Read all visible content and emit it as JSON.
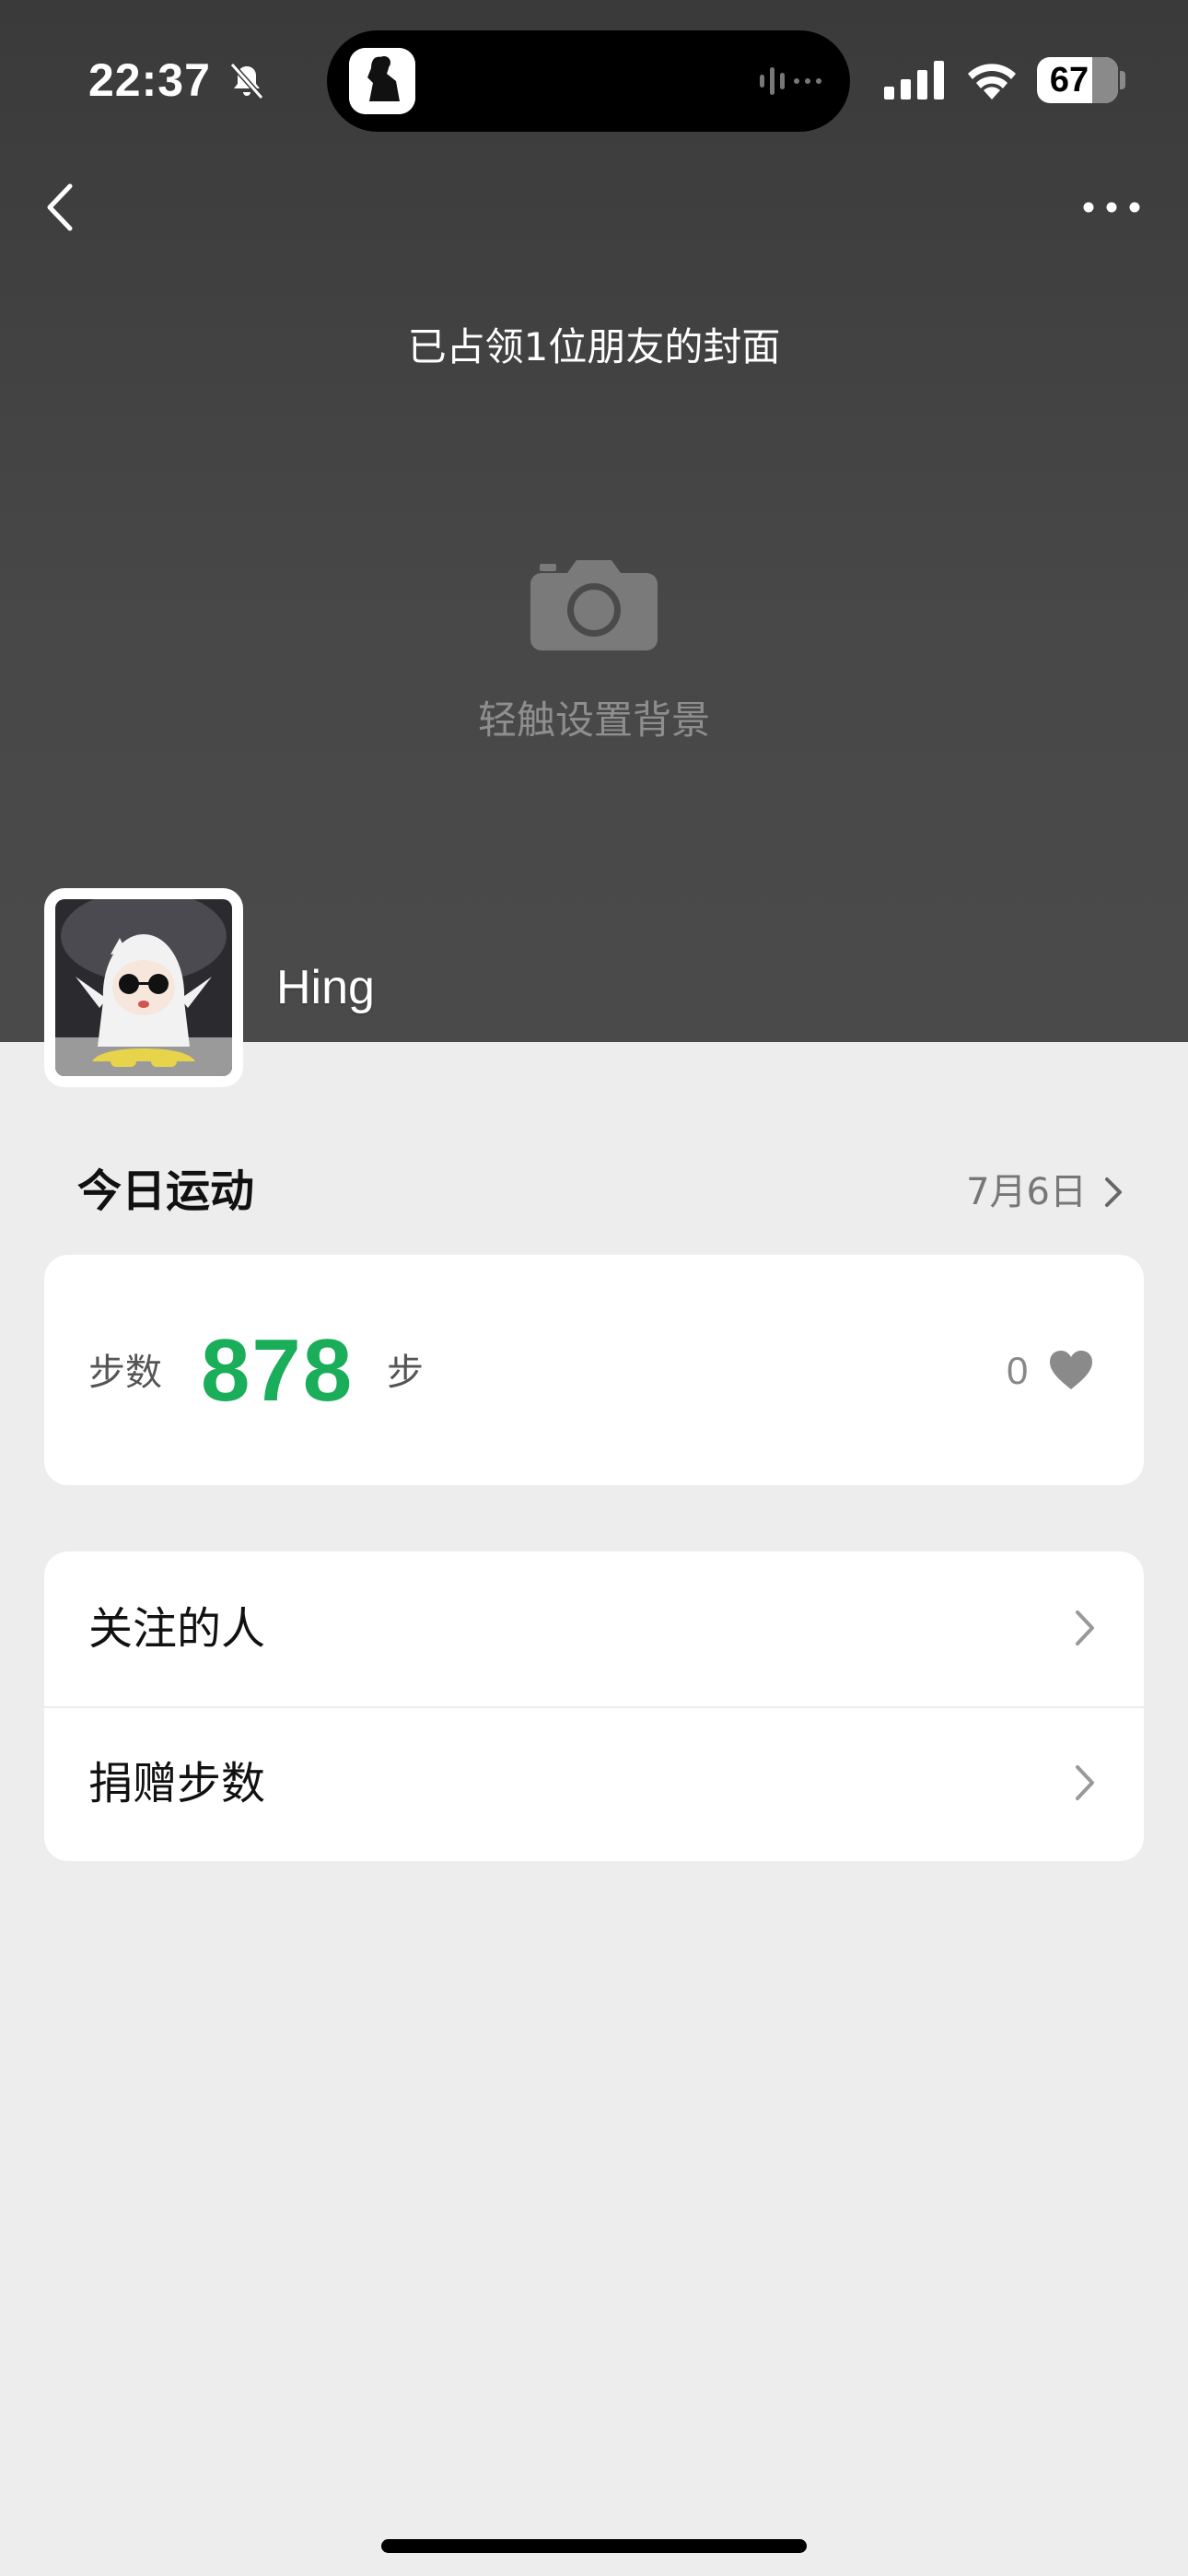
{
  "status_bar": {
    "time": "22:37",
    "battery": "67"
  },
  "header": {
    "cover_note": "已占领1位朋友的封面",
    "tap_to_set_background": "轻触设置背景"
  },
  "profile": {
    "username": "Hing"
  },
  "today": {
    "title": "今日运动",
    "date": "7月6日"
  },
  "steps": {
    "label": "步数",
    "value": "878",
    "unit": "步",
    "likes": "0",
    "value_color": "#1aad5a"
  },
  "menu": {
    "items": [
      {
        "label": "关注的人",
        "icon": "chevron-right-icon"
      },
      {
        "label": "捐赠步数",
        "icon": "chevron-right-icon"
      }
    ]
  }
}
